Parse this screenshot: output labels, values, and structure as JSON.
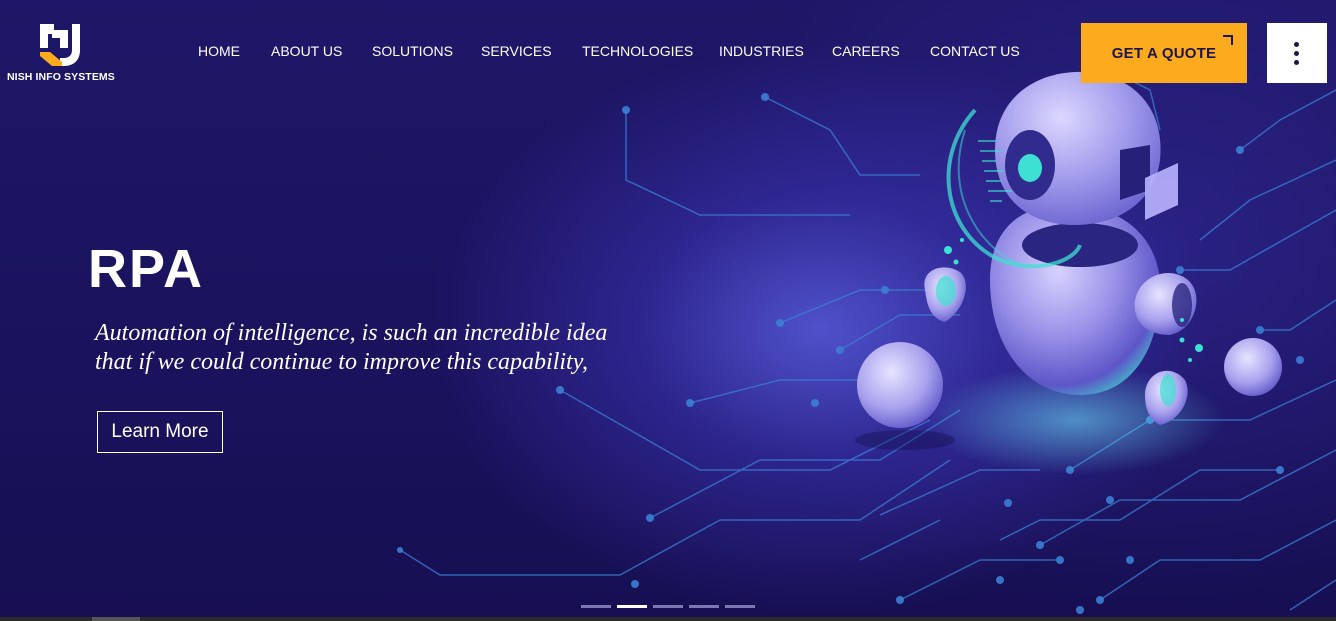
{
  "brand": {
    "name": "NISH INFO SYSTEMS"
  },
  "nav": {
    "items": [
      {
        "label": "HOME"
      },
      {
        "label": "ABOUT US"
      },
      {
        "label": "SOLUTIONS"
      },
      {
        "label": "SERVICES"
      },
      {
        "label": "TECHNOLOGIES"
      },
      {
        "label": "INDUSTRIES"
      },
      {
        "label": "CAREERS"
      },
      {
        "label": "CONTACT US"
      }
    ]
  },
  "header": {
    "quote_label": "GET A QUOTE",
    "menu_icon": "vertical-dots-icon"
  },
  "slide": {
    "title": "RPA",
    "text_line1": "Automation of intelligence, is such an incredible idea",
    "text_line2": "that if we could continue to improve this capability,",
    "button_label": "Learn More"
  },
  "slider": {
    "count": 5,
    "active_index": 1
  },
  "colors": {
    "background": "#1b1460",
    "accent": "#fcab1e",
    "robot_body": "#9c95e6",
    "robot_glow": "#3de0d2",
    "circuit": "#3b7fd4"
  }
}
